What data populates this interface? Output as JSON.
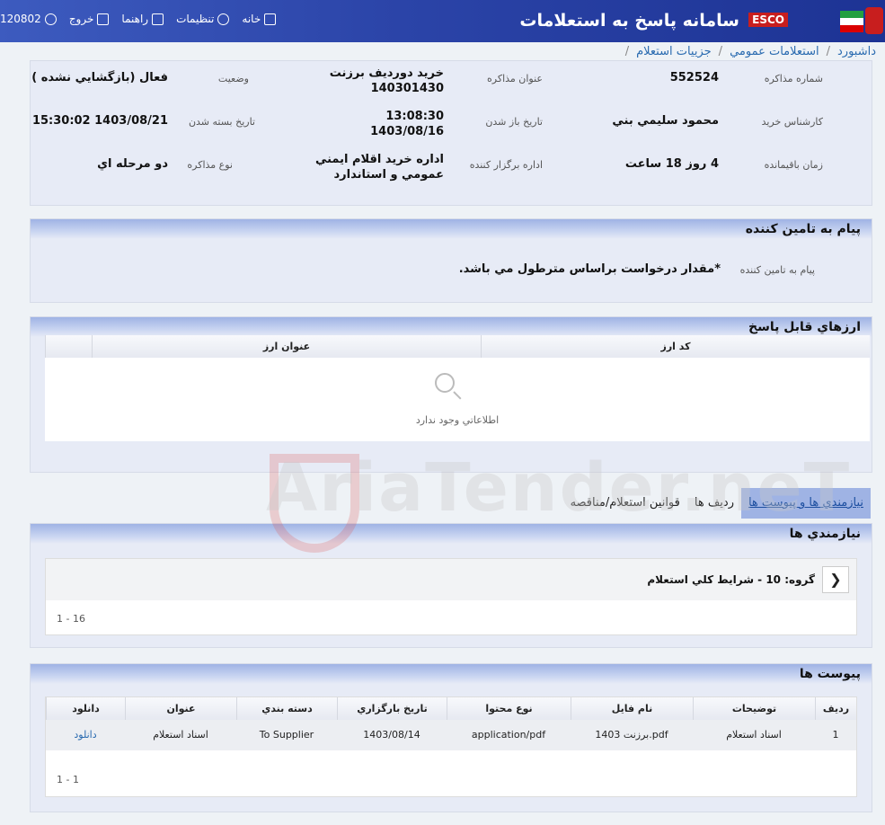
{
  "header": {
    "title": "سامانه پاسخ به استعلامات",
    "brand": "ESCO",
    "user_code": "120802",
    "nav": {
      "logout": "خروج",
      "guide": "راهنما",
      "settings": "تنظيمات",
      "home": "خانه"
    }
  },
  "breadcrumb": [
    "داشبورد",
    "استعلامات عمومي",
    "جزييات استعلام"
  ],
  "details": {
    "number_label": "شماره مذاکره",
    "number": "552524",
    "title_label": "عنوان مذاکره",
    "title_line1": "خريد دورديف برزنت",
    "title_line2": "140301430",
    "status_label": "وضعيت",
    "status": "فعال (بازگشايي نشده )",
    "expert_label": "کارشناس خريد",
    "expert": "محمود سليمي بني",
    "open_label": "تاريخ باز شدن",
    "open_time": "13:08:30",
    "open_date": "1403/08/16",
    "close_label": "تاريخ بسته شدن",
    "close": "1403/08/21 15:30:02",
    "remaining_label": "زمان باقيمانده",
    "remaining": "4 روز 18 ساعت",
    "dept_label": "اداره برگزار کننده",
    "dept_line1": "اداره خريد اقلام ايمني",
    "dept_line2": "عمومي و استاندارد",
    "type_label": "نوع مذاکره",
    "type": "دو مرحله اي"
  },
  "supplier_msg": {
    "title": "پيام به تامين کننده",
    "label": "پيام به تامين کننده",
    "text": "*مقدار درخواست براساس مترطول مي باشد."
  },
  "currencies": {
    "title": "ارزهاي قابل پاسخ",
    "columns": [
      "کد ارز",
      "عنوان ارز"
    ],
    "empty": "اطلاعاتي وجود ندارد"
  },
  "tabs": [
    "نيازمندي ها و پيوست ها",
    "رديف ها",
    "قوانين استعلام/مناقصه"
  ],
  "needs": {
    "title": "نيازمندي ها",
    "group": "گروه: 10 - شرايط کلي استعلام",
    "pager": "1 - 16"
  },
  "attachments": {
    "title": "پيوست ها",
    "columns": [
      "رديف",
      "توضيحات",
      "نام فايل",
      "نوع محتوا",
      "تاريخ بارگزاري",
      "دسته بندي",
      "عنوان",
      "دانلود"
    ],
    "rows": [
      {
        "idx": "1",
        "desc": "اسناد استعلام",
        "file": "برزنت 1403.pdf",
        "mime": "application/pdf",
        "date": "1403/08/14",
        "cat": "To Supplier",
        "title": "اسناد استعلام",
        "download": "دانلود"
      }
    ],
    "pager": "1 - 1"
  },
  "watermark": "AriaTender.neT"
}
